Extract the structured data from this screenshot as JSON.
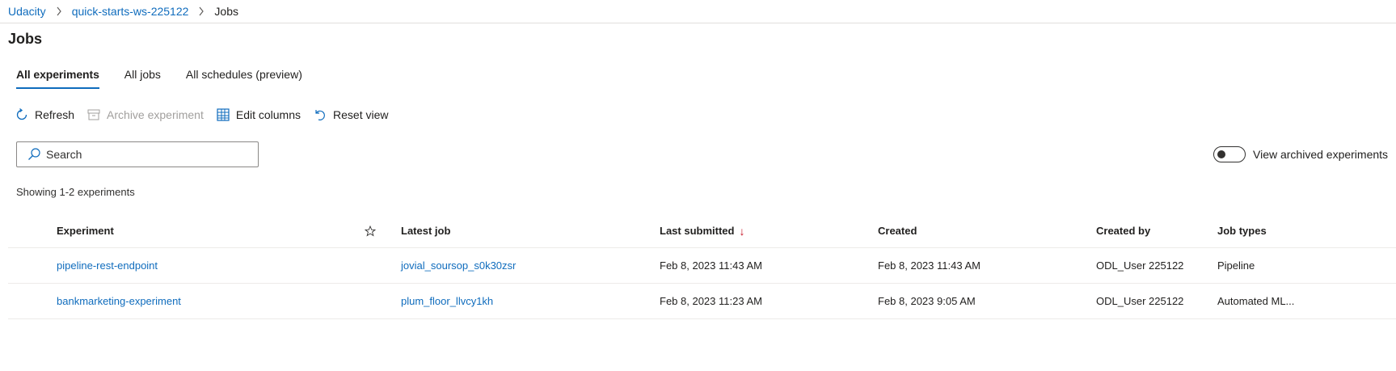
{
  "breadcrumb": {
    "items": [
      "Udacity",
      "quick-starts-ws-225122"
    ],
    "current": "Jobs"
  },
  "page_title": "Jobs",
  "tabs": [
    {
      "label": "All experiments",
      "active": true
    },
    {
      "label": "All jobs",
      "active": false
    },
    {
      "label": "All schedules (preview)",
      "active": false
    }
  ],
  "toolbar": {
    "refresh": "Refresh",
    "archive": "Archive experiment",
    "edit_columns": "Edit columns",
    "reset_view": "Reset view"
  },
  "search": {
    "placeholder": "Search",
    "value": ""
  },
  "toggle": {
    "label": "View archived experiments",
    "on": false
  },
  "showing": "Showing 1-2 experiments",
  "table": {
    "headers": {
      "experiment": "Experiment",
      "latest_job": "Latest job",
      "last_submitted": "Last submitted",
      "created": "Created",
      "created_by": "Created by",
      "job_types": "Job types"
    },
    "sort_icon": "↓",
    "rows": [
      {
        "experiment": "pipeline-rest-endpoint",
        "latest_job": "jovial_soursop_s0k30zsr",
        "last_submitted": "Feb 8, 2023 11:43 AM",
        "created": "Feb 8, 2023 11:43 AM",
        "created_by": "ODL_User 225122",
        "job_types": "Pipeline"
      },
      {
        "experiment": "bankmarketing-experiment",
        "latest_job": "plum_floor_llvcy1kh",
        "last_submitted": "Feb 8, 2023 11:23 AM",
        "created": "Feb 8, 2023 9:05 AM",
        "created_by": "ODL_User 225122",
        "job_types": "Automated ML..."
      }
    ]
  },
  "colors": {
    "accent": "#0f6cbd",
    "sort_arrow": "#c50f1f"
  }
}
